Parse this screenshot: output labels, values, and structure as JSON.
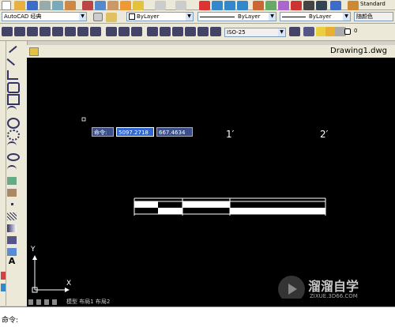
{
  "toolbar_top": {
    "workspace": "AutoCAD 经典",
    "layer_name": "ByLayer",
    "linetype": "ByLayer",
    "lineweight": "ByLayer",
    "plotstyle": "随颜色",
    "textstyle": "Standard",
    "dimstyle": "ISO-25",
    "layer_value": "0"
  },
  "drawing": {
    "title": "Drawing1.dwg",
    "scale_labels": [
      "1′",
      "2′"
    ],
    "ucs_x": "X",
    "ucs_y": "Y"
  },
  "dynamic_input": {
    "prompt": "命令:",
    "value1": "5097.2718",
    "value2": "667.4634"
  },
  "layout_tabs": {
    "text": "模型 布局1 布局2"
  },
  "command_line": {
    "text": "命令:"
  },
  "watermark": {
    "cn": "溜溜自学",
    "url": "ZIXUE.3D66.COM"
  },
  "colors": {
    "accent_blue": "#1a3fd0",
    "canvas_bg": "#000000",
    "tooltip_bg": "#3a4f8a",
    "tooltip_edit": "#3366cc"
  }
}
